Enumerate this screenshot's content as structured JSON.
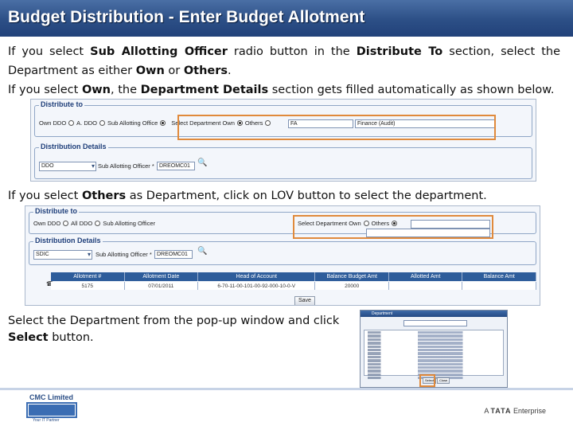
{
  "title": "Budget Distribution - Enter Budget Allotment",
  "paragraph1": {
    "t1": "If you select ",
    "b1": "Sub Allotting Officer",
    "t2": " radio button in the ",
    "b2": "Distribute To",
    "t3": " section, select the Department as either ",
    "b3": "Own",
    "t4": " or ",
    "b4": "Others",
    "t5": "."
  },
  "paragraph2": {
    "t1": "If you select ",
    "b1": "Own",
    "t2": ", the ",
    "b2": "Department Details",
    "t3": " section gets filled automatically as shown below."
  },
  "paragraph3": {
    "t1": "If you select ",
    "b1": "Others",
    "t2": " as Department, click on LOV button to select the department."
  },
  "paragraph4": {
    "t1": "Select the Department from the pop-up window and click ",
    "b1": "Select",
    "t2": " button."
  },
  "shot1": {
    "distribute_legend": "Distribute to",
    "own_ddo": "Own DDO",
    "a_ddo": "A. DDO",
    "sub_allotting": "Sub Allotting Office",
    "select_dept": "Select Department Own",
    "others": "Others",
    "dept_code": "FA",
    "dept_name": "Finance (Audit)",
    "details_legend": "Distribution Details",
    "ddo_select": "DDO",
    "sub_officer_label": "Sub Allotting Officer *",
    "sub_officer_value": "DREOMC01"
  },
  "shot2": {
    "distribute_legend": "Distribute to",
    "own_ddo": "Own DDO",
    "all_ddo": "All DDO",
    "sub_allotting": "Sub Allotting Officer",
    "select_dept": "Select Department Own",
    "others": "Others",
    "details_legend": "Distribution Details",
    "ddo_select": "SDIC",
    "sub_officer_label": "Sub Allotting Officer *",
    "sub_officer_value": "DREOMC01",
    "grid_headers": [
      "Allotment #",
      "Allotment Date",
      "Head of Account",
      "Balance Budget Amt",
      "Allotted Amt",
      "Balance Amt"
    ],
    "grid_row": [
      "5175",
      "07/01/2011",
      "6-70-11-00-101-00-92-000-10-0-V",
      "20000",
      "",
      ""
    ],
    "save": "Save"
  },
  "popup": {
    "title": "Department",
    "select_btn": "Select",
    "close_btn": "Close"
  },
  "footer": {
    "company": "CMC Limited",
    "tagline": "Your IT Partner",
    "tata_prefix": "A",
    "tata_brand": "TATA",
    "tata_suffix": "Enterprise"
  },
  "colors": {
    "title_bar": "#2c4f86",
    "highlight": "#e08a3c"
  }
}
